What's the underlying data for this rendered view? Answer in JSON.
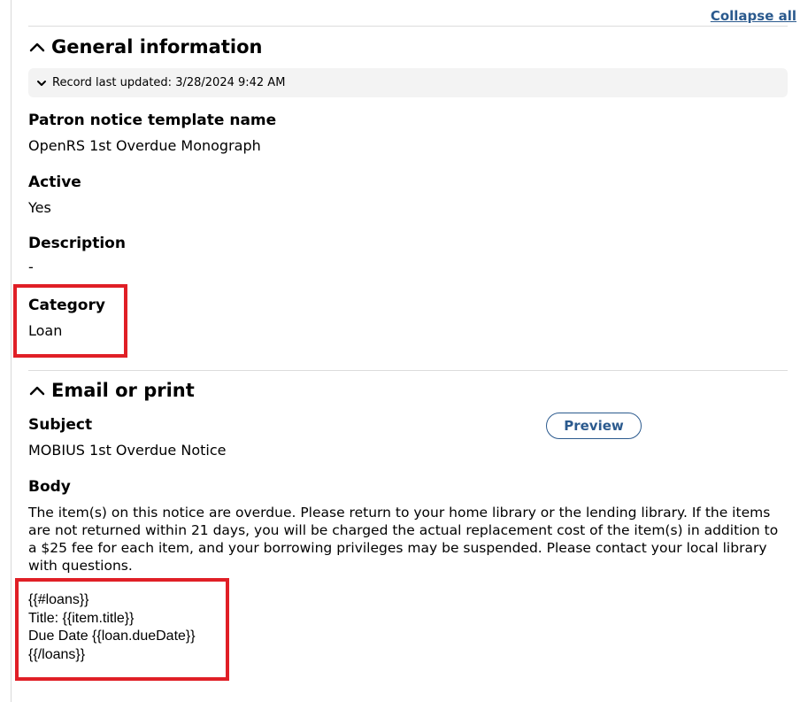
{
  "toolbar": {
    "collapse_all_label": "Collapse all"
  },
  "general": {
    "title": "General information",
    "record_updated": "Record last updated: 3/28/2024 9:42 AM",
    "fields": {
      "name_label": "Patron notice template name",
      "name_value": "OpenRS 1st Overdue Monograph",
      "active_label": "Active",
      "active_value": "Yes",
      "description_label": "Description",
      "description_value": "-",
      "category_label": "Category",
      "category_value": "Loan"
    }
  },
  "email": {
    "title": "Email or print",
    "subject_label": "Subject",
    "subject_value": "MOBIUS 1st Overdue Notice",
    "preview_label": "Preview",
    "body_label": "Body",
    "body_text": "The item(s) on this notice are overdue. Please return to your home library or the lending library. If the items are not returned within 21 days, you will be charged the actual replacement cost of the item(s) in addition to a $25 fee for each item, and your borrowing privileges may be suspended. Please contact your local library with questions.",
    "template_lines": [
      "{{#loans}}",
      "Title: {{item.title}}",
      "Due Date {{loan.dueDate}}",
      "{{/loans}}"
    ]
  },
  "icons": {
    "section_toggle": "chevron-up-icon",
    "meta_toggle": "chevron-down-icon"
  },
  "colors": {
    "link": "#2b5a8e",
    "highlight": "#e01f26",
    "meta_bg": "#f3f3f3"
  }
}
